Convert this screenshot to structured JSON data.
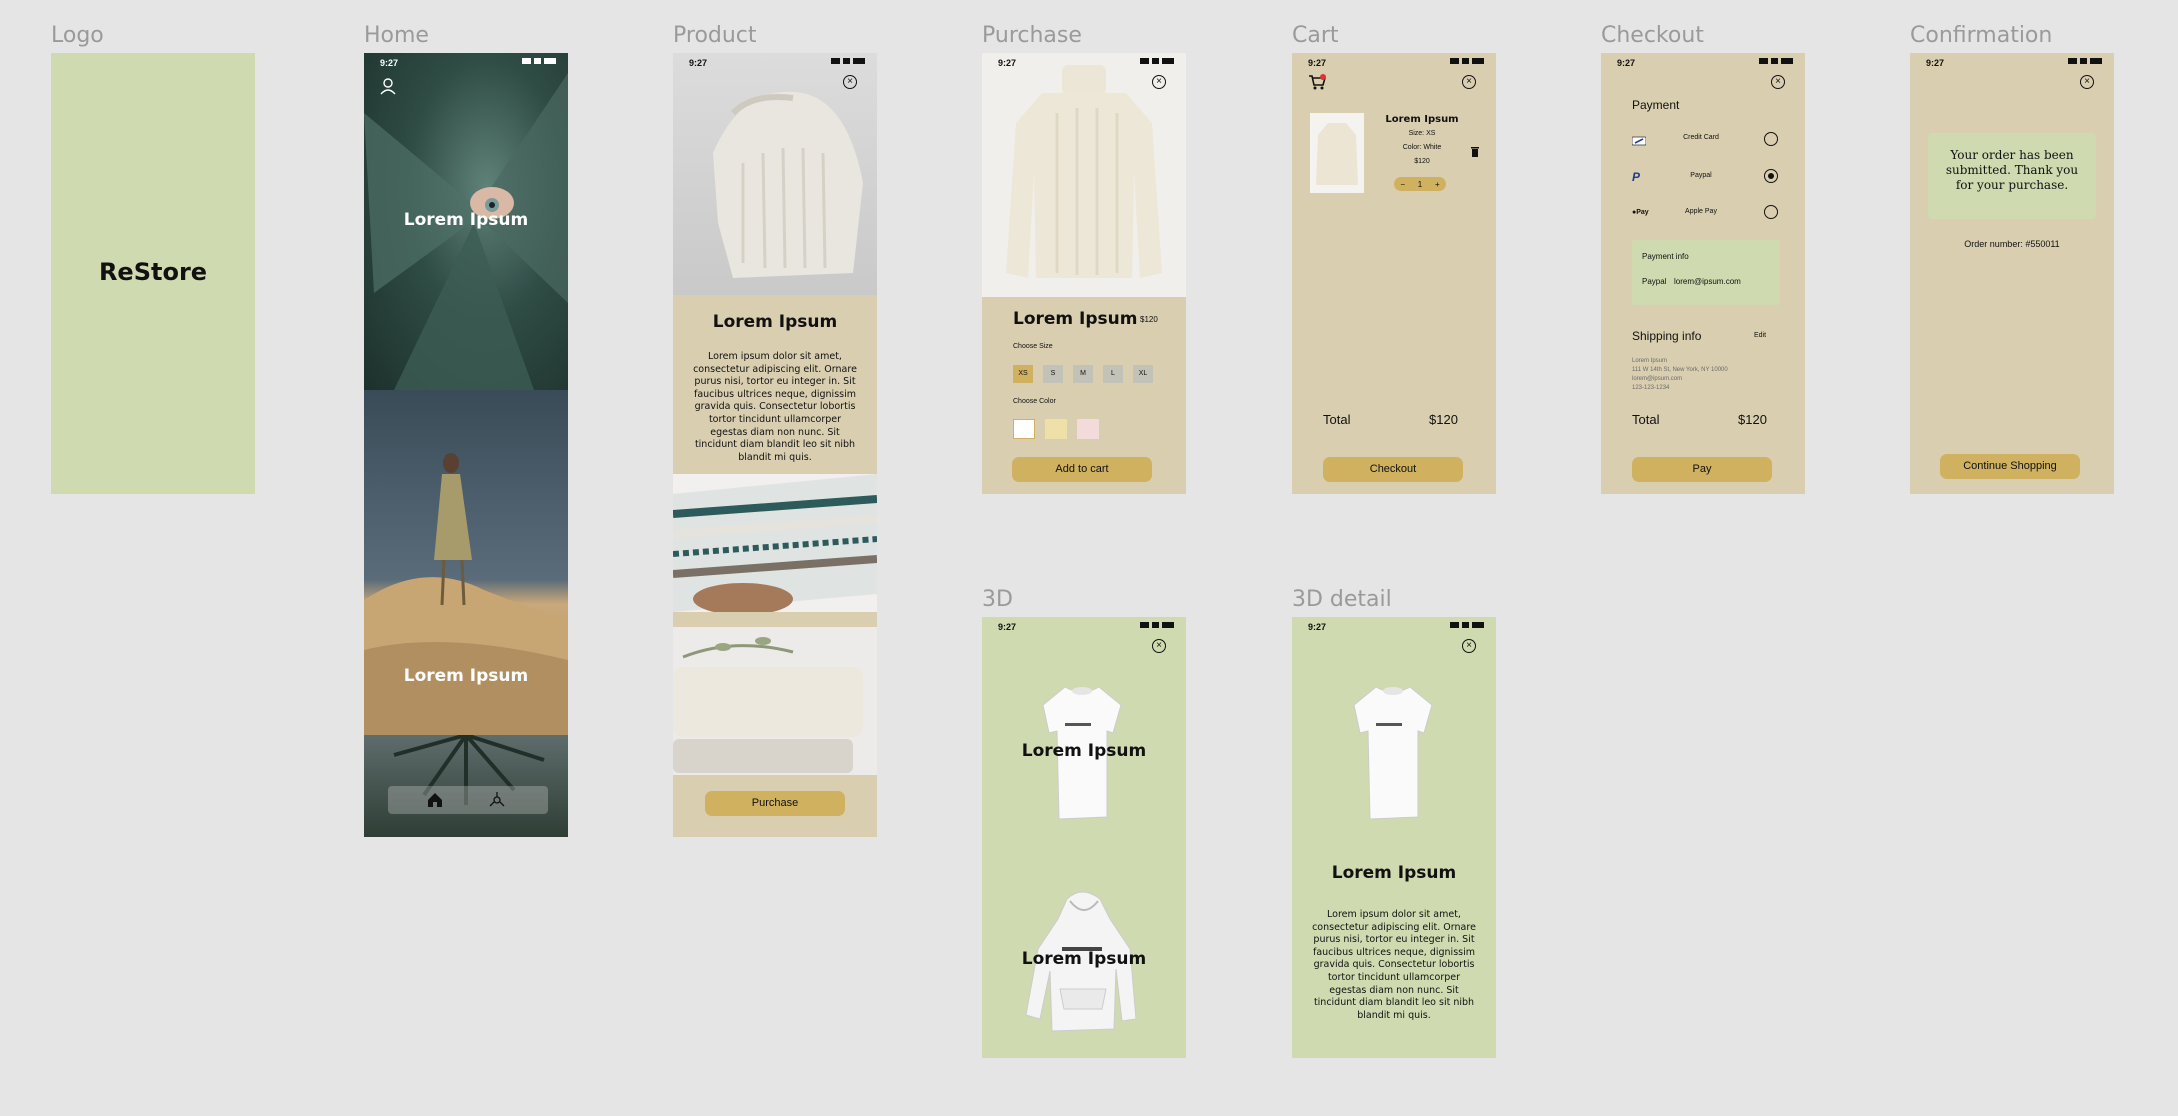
{
  "labels": {
    "logo": "Logo",
    "home": "Home",
    "product": "Product",
    "purchase": "Purchase",
    "cart": "Cart",
    "checkout": "Checkout",
    "confirmation": "Confirmation",
    "three_d": "3D",
    "three_d_detail": "3D detail"
  },
  "status_time": "9:27",
  "logo_text": "ReStore",
  "home": {
    "banner1": "Lorem Ipsum",
    "banner2": "Lorem Ipsum"
  },
  "product": {
    "title": "Lorem Ipsum",
    "description": "Lorem ipsum dolor sit amet, consectetur adipiscing elit. Ornare purus nisi, tortor eu integer in. Sit faucibus ultrices neque, dignissim gravida quis. Consectetur lobortis tortor tincidunt ullamcorper egestas diam non nunc. Sit tincidunt diam blandit leo sit nibh blandit mi quis.",
    "purchase_button": "Purchase"
  },
  "purchase": {
    "title": "Lorem Ipsum",
    "price": "$120",
    "choose_size": "Choose Size",
    "sizes": [
      "XS",
      "S",
      "M",
      "L",
      "XL"
    ],
    "choose_color": "Choose Color",
    "add_to_cart": "Add to cart"
  },
  "cart": {
    "item_name": "Lorem Ipsum",
    "size": "Size: XS",
    "color": "Color: White",
    "price": "$120",
    "qty_minus": "−",
    "qty": "1",
    "qty_plus": "+",
    "total_label": "Total",
    "total_value": "$120",
    "checkout_button": "Checkout"
  },
  "checkout": {
    "payment_heading": "Payment",
    "methods": [
      "Credit Card",
      "Paypal",
      "Apple Pay"
    ],
    "apple_pay_mark": "Pay",
    "payment_info_heading": "Payment info",
    "payment_info_method": "Paypal",
    "payment_info_email": "lorem@ipsum.com",
    "shipping_heading": "Shipping info",
    "edit": "Edit",
    "address_lines": [
      "Lorem Ipsum",
      "111 W 14th St, New York, NY 10000",
      "lorem@ipsum.com",
      "123-123-1234"
    ],
    "total_label": "Total",
    "total_value": "$120",
    "pay_button": "Pay"
  },
  "confirmation": {
    "message": "Your order has been submitted. Thank you for your purchase.",
    "order_number": "Order number: #550011",
    "continue_button": "Continue Shopping"
  },
  "three_d": {
    "item1": "Lorem Ipsum",
    "item2": "Lorem Ipsum"
  },
  "three_d_detail": {
    "title": "Lorem Ipsum",
    "description": "Lorem ipsum dolor sit amet, consectetur adipiscing elit. Ornare purus nisi, tortor eu integer in. Sit faucibus ultrices neque, dignissim gravida quis. Consectetur lobortis tortor tincidunt ullamcorper egestas diam non nunc. Sit tincidunt diam blandit leo sit nibh blandit mi quis."
  },
  "colors": {
    "background": "#e5e5e5",
    "beige": "#d9ceb0",
    "green": "#cfdab0",
    "accent": "#cfb15f"
  }
}
